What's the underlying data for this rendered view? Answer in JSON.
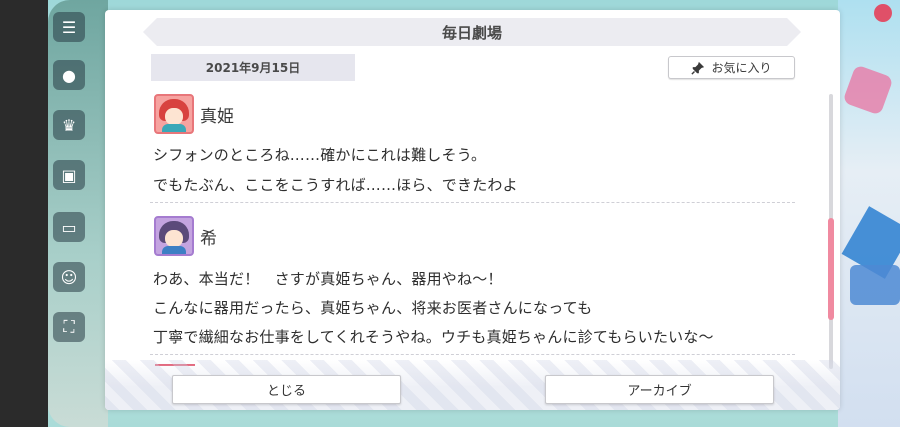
{
  "dialog": {
    "title": "毎日劇場",
    "date": "2021年9月15日",
    "favorite_label": "お気に入り"
  },
  "entries": [
    {
      "speaker": "真姫",
      "lines": [
        "シフォンのところね……確かにこれは難しそう。",
        "でもたぶん、ここをこうすれば……ほら、できたわよ"
      ]
    },
    {
      "speaker": "希",
      "lines": [
        "わあ、本当だ！　さすが真姫ちゃん、器用やね～！",
        "こんなに器用だったら、真姫ちゃん、将来お医者さんになっても",
        "丁寧で繊細なお仕事をしてくれそうやね。ウチも真姫ちゃんに診てもらいたいな～"
      ]
    }
  ],
  "buttons": {
    "close_label": "とじる",
    "archive_label": "アーカイブ"
  },
  "scroll_position": 0.6,
  "colors": {
    "accent_pink": "#f08aa0",
    "title_bg": "#ececf1"
  }
}
